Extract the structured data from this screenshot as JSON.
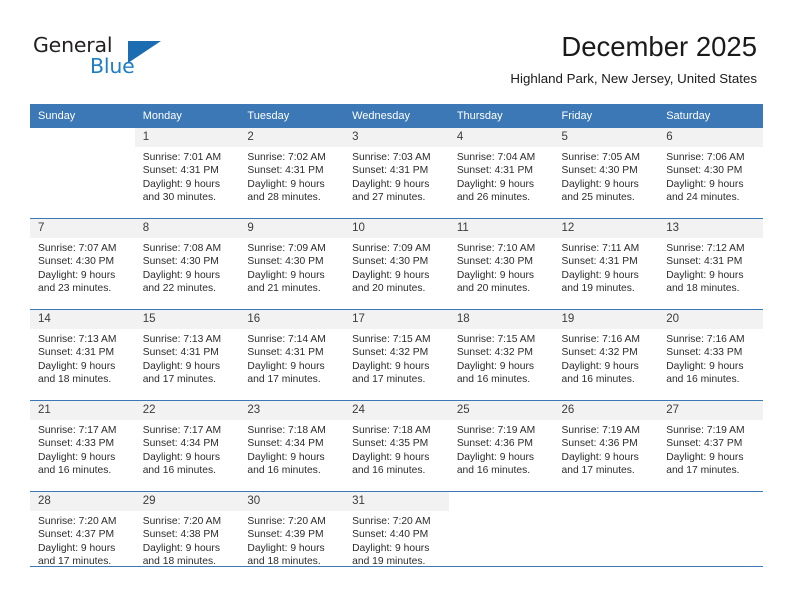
{
  "brand": {
    "name_part1": "General",
    "name_part2": "Blue",
    "triangle_color": "#1b6cb0",
    "blue_color": "#1f7dc4"
  },
  "header": {
    "month_title": "December 2025",
    "location": "Highland Park, New Jersey, United States"
  },
  "calendar": {
    "header_bg": "#3b78b5",
    "weekday_headers": [
      "Sunday",
      "Monday",
      "Tuesday",
      "Wednesday",
      "Thursday",
      "Friday",
      "Saturday"
    ],
    "weeks": [
      [
        {
          "day": "",
          "lines": [],
          "blank": true
        },
        {
          "day": "1",
          "lines": [
            "Sunrise: 7:01 AM",
            "Sunset: 4:31 PM",
            "Daylight: 9 hours",
            "and 30 minutes."
          ]
        },
        {
          "day": "2",
          "lines": [
            "Sunrise: 7:02 AM",
            "Sunset: 4:31 PM",
            "Daylight: 9 hours",
            "and 28 minutes."
          ]
        },
        {
          "day": "3",
          "lines": [
            "Sunrise: 7:03 AM",
            "Sunset: 4:31 PM",
            "Daylight: 9 hours",
            "and 27 minutes."
          ]
        },
        {
          "day": "4",
          "lines": [
            "Sunrise: 7:04 AM",
            "Sunset: 4:31 PM",
            "Daylight: 9 hours",
            "and 26 minutes."
          ]
        },
        {
          "day": "5",
          "lines": [
            "Sunrise: 7:05 AM",
            "Sunset: 4:30 PM",
            "Daylight: 9 hours",
            "and 25 minutes."
          ]
        },
        {
          "day": "6",
          "lines": [
            "Sunrise: 7:06 AM",
            "Sunset: 4:30 PM",
            "Daylight: 9 hours",
            "and 24 minutes."
          ]
        }
      ],
      [
        {
          "day": "7",
          "lines": [
            "Sunrise: 7:07 AM",
            "Sunset: 4:30 PM",
            "Daylight: 9 hours",
            "and 23 minutes."
          ]
        },
        {
          "day": "8",
          "lines": [
            "Sunrise: 7:08 AM",
            "Sunset: 4:30 PM",
            "Daylight: 9 hours",
            "and 22 minutes."
          ]
        },
        {
          "day": "9",
          "lines": [
            "Sunrise: 7:09 AM",
            "Sunset: 4:30 PM",
            "Daylight: 9 hours",
            "and 21 minutes."
          ]
        },
        {
          "day": "10",
          "lines": [
            "Sunrise: 7:09 AM",
            "Sunset: 4:30 PM",
            "Daylight: 9 hours",
            "and 20 minutes."
          ]
        },
        {
          "day": "11",
          "lines": [
            "Sunrise: 7:10 AM",
            "Sunset: 4:30 PM",
            "Daylight: 9 hours",
            "and 20 minutes."
          ]
        },
        {
          "day": "12",
          "lines": [
            "Sunrise: 7:11 AM",
            "Sunset: 4:31 PM",
            "Daylight: 9 hours",
            "and 19 minutes."
          ]
        },
        {
          "day": "13",
          "lines": [
            "Sunrise: 7:12 AM",
            "Sunset: 4:31 PM",
            "Daylight: 9 hours",
            "and 18 minutes."
          ]
        }
      ],
      [
        {
          "day": "14",
          "lines": [
            "Sunrise: 7:13 AM",
            "Sunset: 4:31 PM",
            "Daylight: 9 hours",
            "and 18 minutes."
          ]
        },
        {
          "day": "15",
          "lines": [
            "Sunrise: 7:13 AM",
            "Sunset: 4:31 PM",
            "Daylight: 9 hours",
            "and 17 minutes."
          ]
        },
        {
          "day": "16",
          "lines": [
            "Sunrise: 7:14 AM",
            "Sunset: 4:31 PM",
            "Daylight: 9 hours",
            "and 17 minutes."
          ]
        },
        {
          "day": "17",
          "lines": [
            "Sunrise: 7:15 AM",
            "Sunset: 4:32 PM",
            "Daylight: 9 hours",
            "and 17 minutes."
          ]
        },
        {
          "day": "18",
          "lines": [
            "Sunrise: 7:15 AM",
            "Sunset: 4:32 PM",
            "Daylight: 9 hours",
            "and 16 minutes."
          ]
        },
        {
          "day": "19",
          "lines": [
            "Sunrise: 7:16 AM",
            "Sunset: 4:32 PM",
            "Daylight: 9 hours",
            "and 16 minutes."
          ]
        },
        {
          "day": "20",
          "lines": [
            "Sunrise: 7:16 AM",
            "Sunset: 4:33 PM",
            "Daylight: 9 hours",
            "and 16 minutes."
          ]
        }
      ],
      [
        {
          "day": "21",
          "lines": [
            "Sunrise: 7:17 AM",
            "Sunset: 4:33 PM",
            "Daylight: 9 hours",
            "and 16 minutes."
          ]
        },
        {
          "day": "22",
          "lines": [
            "Sunrise: 7:17 AM",
            "Sunset: 4:34 PM",
            "Daylight: 9 hours",
            "and 16 minutes."
          ]
        },
        {
          "day": "23",
          "lines": [
            "Sunrise: 7:18 AM",
            "Sunset: 4:34 PM",
            "Daylight: 9 hours",
            "and 16 minutes."
          ]
        },
        {
          "day": "24",
          "lines": [
            "Sunrise: 7:18 AM",
            "Sunset: 4:35 PM",
            "Daylight: 9 hours",
            "and 16 minutes."
          ]
        },
        {
          "day": "25",
          "lines": [
            "Sunrise: 7:19 AM",
            "Sunset: 4:36 PM",
            "Daylight: 9 hours",
            "and 16 minutes."
          ]
        },
        {
          "day": "26",
          "lines": [
            "Sunrise: 7:19 AM",
            "Sunset: 4:36 PM",
            "Daylight: 9 hours",
            "and 17 minutes."
          ]
        },
        {
          "day": "27",
          "lines": [
            "Sunrise: 7:19 AM",
            "Sunset: 4:37 PM",
            "Daylight: 9 hours",
            "and 17 minutes."
          ]
        }
      ],
      [
        {
          "day": "28",
          "lines": [
            "Sunrise: 7:20 AM",
            "Sunset: 4:37 PM",
            "Daylight: 9 hours",
            "and 17 minutes."
          ]
        },
        {
          "day": "29",
          "lines": [
            "Sunrise: 7:20 AM",
            "Sunset: 4:38 PM",
            "Daylight: 9 hours",
            "and 18 minutes."
          ]
        },
        {
          "day": "30",
          "lines": [
            "Sunrise: 7:20 AM",
            "Sunset: 4:39 PM",
            "Daylight: 9 hours",
            "and 18 minutes."
          ]
        },
        {
          "day": "31",
          "lines": [
            "Sunrise: 7:20 AM",
            "Sunset: 4:40 PM",
            "Daylight: 9 hours",
            "and 19 minutes."
          ]
        },
        {
          "day": "",
          "lines": [],
          "blank": true
        },
        {
          "day": "",
          "lines": [],
          "blank": true
        },
        {
          "day": "",
          "lines": [],
          "blank": true
        }
      ]
    ]
  }
}
